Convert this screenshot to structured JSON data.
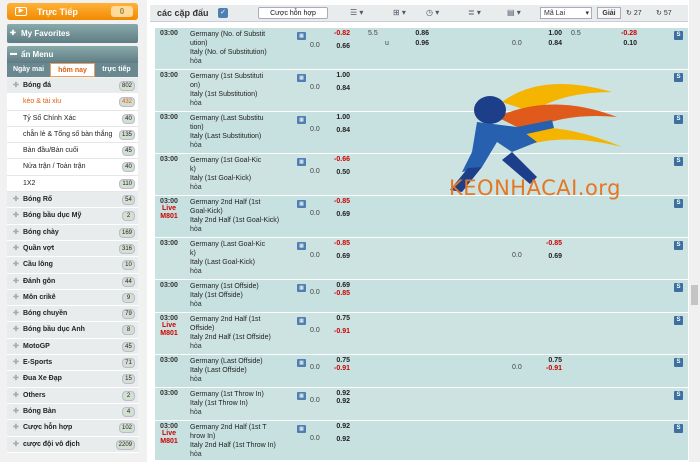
{
  "sidebar": {
    "live": {
      "label": "Trực Tiếp",
      "count": "0"
    },
    "favorites": "My Favorites",
    "menu": "ẩn Menu",
    "tabs": [
      "Ngày mai",
      "hôm nay",
      "trực tiếp"
    ],
    "items": [
      {
        "label": "Bóng đá",
        "count": "802",
        "sub": false
      },
      {
        "label": "kèo & tài xỉu",
        "count": "432",
        "sub": true,
        "hl": true
      },
      {
        "label": "Tỷ Số Chính Xác",
        "count": "40",
        "sub": true
      },
      {
        "label": "chẵn lẻ & Tổng số bàn thắng",
        "count": "135",
        "sub": true
      },
      {
        "label": "Bàn đầu/Bàn cuối",
        "count": "45",
        "sub": true
      },
      {
        "label": "Nửa trận / Toàn trận",
        "count": "40",
        "sub": true
      },
      {
        "label": "1X2",
        "count": "110",
        "sub": true
      },
      {
        "label": "Bóng Rổ",
        "count": "54",
        "sub": false
      },
      {
        "label": "Bóng bầu dục Mỹ",
        "count": "2",
        "sub": false
      },
      {
        "label": "Bóng chày",
        "count": "169",
        "sub": false
      },
      {
        "label": "Quần vợt",
        "count": "316",
        "sub": false
      },
      {
        "label": "Cầu lông",
        "count": "10",
        "sub": false
      },
      {
        "label": "Đánh gôn",
        "count": "44",
        "sub": false
      },
      {
        "label": "Môn crikê",
        "count": "9",
        "sub": false
      },
      {
        "label": "Bóng chuyền",
        "count": "79",
        "sub": false
      },
      {
        "label": "Bóng bầu dục Anh",
        "count": "8",
        "sub": false
      },
      {
        "label": "MotoGP",
        "count": "45",
        "sub": false
      },
      {
        "label": "E-Sports",
        "count": "71",
        "sub": false
      },
      {
        "label": "Đua Xe Đạp",
        "count": "15",
        "sub": false
      },
      {
        "label": "Others",
        "count": "2",
        "sub": false
      },
      {
        "label": "Bóng Bàn",
        "count": "4",
        "sub": false
      },
      {
        "label": "Cược hỗn hợp",
        "count": "102",
        "sub": false
      },
      {
        "label": "cược đội vô địch",
        "count": "2209",
        "sub": false
      }
    ]
  },
  "toolbar": {
    "title": "các cặp đấu",
    "mix": "Cược hỗn hợp",
    "odds_type": "Mã Lai",
    "solve": "Giải",
    "count1": "27",
    "count2": "57"
  },
  "rows": [
    {
      "time": "03:00",
      "live": "",
      "teams": [
        "Germany (No. of Substit",
        "ution)",
        "Italy (No. of Substitution)"
      ],
      "draw": "hòa",
      "hdp": [
        "0.0",
        ""
      ],
      "odds": [
        "-0.82",
        "0.66"
      ],
      "extra": {
        "a": "5.5",
        "b1": "0.86",
        "b2": "0.96",
        "c": "1.00",
        "c2": "0.84",
        "d": "0.5",
        "e1": "-0.28",
        "e2": "0.10",
        "f": "0.0"
      }
    },
    {
      "time": "03:00",
      "live": "",
      "teams": [
        "Germany (1st Substituti",
        "on)",
        "Italy (1st Substitution)"
      ],
      "draw": "hòa",
      "hdp": [
        "0.0",
        ""
      ],
      "odds": [
        "1.00",
        "0.84"
      ]
    },
    {
      "time": "03:00",
      "live": "",
      "teams": [
        "Germany (Last Substitu",
        "tion)",
        "Italy (Last Substitution)"
      ],
      "draw": "hòa",
      "hdp": [
        "0.0",
        ""
      ],
      "odds": [
        "1.00",
        "0.84"
      ]
    },
    {
      "time": "03:00",
      "live": "",
      "teams": [
        "Germany (1st Goal-Kic",
        "k)",
        "Italy (1st Goal-Kick)"
      ],
      "draw": "hòa",
      "hdp": [
        "0.0",
        ""
      ],
      "odds": [
        "-0.66",
        "0.50"
      ]
    },
    {
      "time": "03:00",
      "live": "Live M801",
      "teams": [
        "Germany 2nd Half (1st",
        "Goal-Kick)",
        "Italy 2nd Half (1st Goal-Kick)"
      ],
      "draw": "hòa",
      "hdp": [
        "0.0",
        ""
      ],
      "odds": [
        "-0.85",
        "0.69"
      ]
    },
    {
      "time": "03:00",
      "live": "",
      "teams": [
        "Germany (Last Goal-Kic",
        "k)",
        "Italy (Last Goal-Kick)"
      ],
      "draw": "hòa",
      "hdp": [
        "0.0",
        ""
      ],
      "odds": [
        "-0.85",
        "0.69"
      ],
      "extra2": {
        "h": "0.0",
        "o1": "-0.85",
        "o2": "0.69"
      }
    },
    {
      "time": "03:00",
      "live": "",
      "teams": [
        "Germany (1st Offside)",
        "",
        "Italy (1st Offside)"
      ],
      "draw": "hòa",
      "hdp": [
        "0.0",
        ""
      ],
      "odds": [
        "0.69",
        "-0.85"
      ]
    },
    {
      "time": "03:00",
      "live": "Live M801",
      "teams": [
        "Germany 2nd Half (1st",
        "Offside)",
        "Italy 2nd Half (1st Offside)"
      ],
      "draw": "hòa",
      "hdp": [
        "0.0",
        ""
      ],
      "odds": [
        "0.75",
        "-0.91"
      ]
    },
    {
      "time": "03:00",
      "live": "",
      "teams": [
        "Germany (Last Offside)",
        "",
        "Italy (Last Offside)"
      ],
      "draw": "hòa",
      "hdp": [
        "0.0",
        ""
      ],
      "odds": [
        "0.75",
        "-0.91"
      ],
      "extra2": {
        "h": "0.0",
        "o1": "0.75",
        "o2": "-0.91"
      }
    },
    {
      "time": "03:00",
      "live": "",
      "teams": [
        "Germany (1st Throw In)",
        "",
        "Italy (1st Throw In)"
      ],
      "draw": "hòa",
      "hdp": [
        "0.0",
        ""
      ],
      "odds": [
        "0.92",
        "0.92"
      ]
    },
    {
      "time": "03:00",
      "live": "Live M801",
      "teams": [
        "Germany 2nd Half (1st T",
        "hrow In)",
        "Italy 2nd Half (1st Throw In)"
      ],
      "draw": "hòa",
      "hdp": [
        "0.0",
        ""
      ],
      "odds": [
        "0.92",
        "0.92"
      ]
    }
  ],
  "watermark": "KEONHACAI.org"
}
